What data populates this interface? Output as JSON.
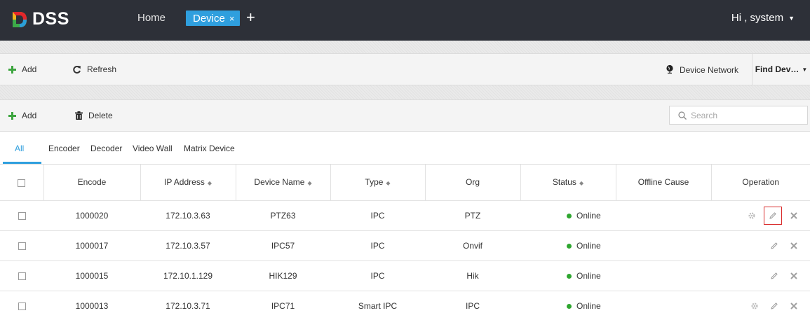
{
  "app": {
    "logo_text": "DSS"
  },
  "nav": {
    "home_label": "Home",
    "active_tab_label": "Device",
    "tab_close": "×",
    "add_tab": "+",
    "user_label": "Hi , system",
    "user_caret": "▼"
  },
  "toolbar1": {
    "add_label": "Add",
    "refresh_label": "Refresh",
    "device_network_label": "Device Network",
    "find_device_label": "Find Dev…",
    "find_caret": "▼"
  },
  "toolbar2": {
    "add_label": "Add",
    "delete_label": "Delete",
    "search_placeholder": "Search"
  },
  "categories": [
    "All",
    "Encoder",
    "Decoder",
    "Video Wall",
    "Matrix Device"
  ],
  "table": {
    "headers": {
      "encode": "Encode",
      "ip": "IP Address",
      "name": "Device Name",
      "type": "Type",
      "org": "Org",
      "status": "Status",
      "offline": "Offline Cause",
      "operation": "Operation"
    },
    "sort_glyph": "◆",
    "rows": [
      {
        "encode": "1000020",
        "ip": "172.10.3.63",
        "name": "PTZ63",
        "type": "IPC",
        "org": "PTZ",
        "status": "Online",
        "offline": ""
      },
      {
        "encode": "1000017",
        "ip": "172.10.3.57",
        "name": "IPC57",
        "type": "IPC",
        "org": "Onvif",
        "status": "Online",
        "offline": ""
      },
      {
        "encode": "1000015",
        "ip": "172.10.1.129",
        "name": "HIK129",
        "type": "IPC",
        "org": "Hik",
        "status": "Online",
        "offline": ""
      },
      {
        "encode": "1000013",
        "ip": "172.10.3.71",
        "name": "IPC71",
        "type": "Smart IPC",
        "org": "IPC",
        "status": "Online",
        "offline": ""
      }
    ]
  },
  "colors": {
    "topbar": "#2d3038",
    "accent": "#2f9fde",
    "online": "#2ea62f",
    "add_green": "#3da53f",
    "highlight": "#d92b2b"
  }
}
